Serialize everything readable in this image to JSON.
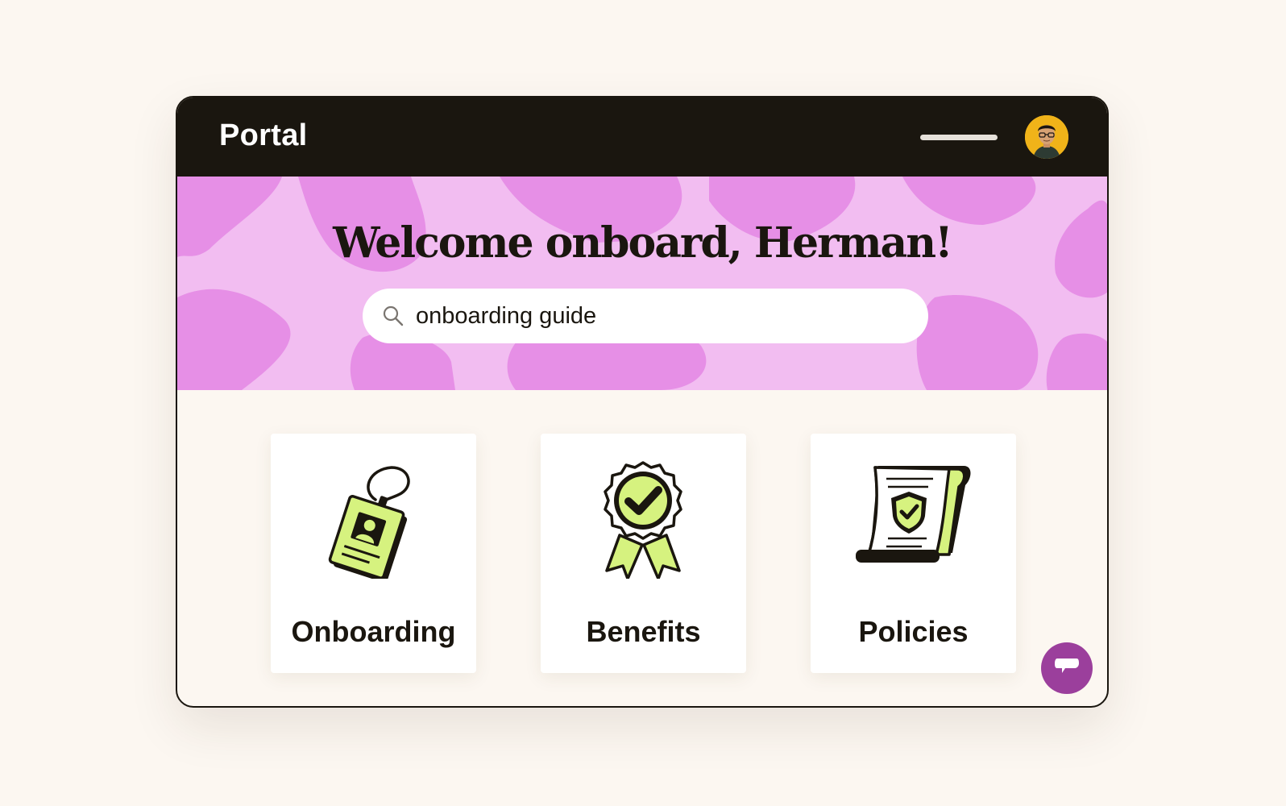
{
  "app": {
    "brand": "Portal"
  },
  "header": {
    "avatar_alt": "Herman avatar"
  },
  "hero": {
    "headline": "Welcome onboard, Herman!",
    "search": {
      "value": "onboarding guide",
      "icon": "search-icon"
    }
  },
  "cards": [
    {
      "label": "Onboarding",
      "icon": "id-badge-icon"
    },
    {
      "label": "Benefits",
      "icon": "award-ribbon-icon"
    },
    {
      "label": "Policies",
      "icon": "policy-scroll-icon"
    }
  ],
  "chat": {
    "icon": "chat-bubble-icon"
  },
  "colors": {
    "page_bg": "#fcf7f1",
    "topbar": "#1a160f",
    "hero_light": "#f2bdf1",
    "hero_dark": "#e68fe6",
    "accent_green": "#d6f27f",
    "chat_purple": "#9b3f9c",
    "avatar_yellow": "#f0b319"
  }
}
